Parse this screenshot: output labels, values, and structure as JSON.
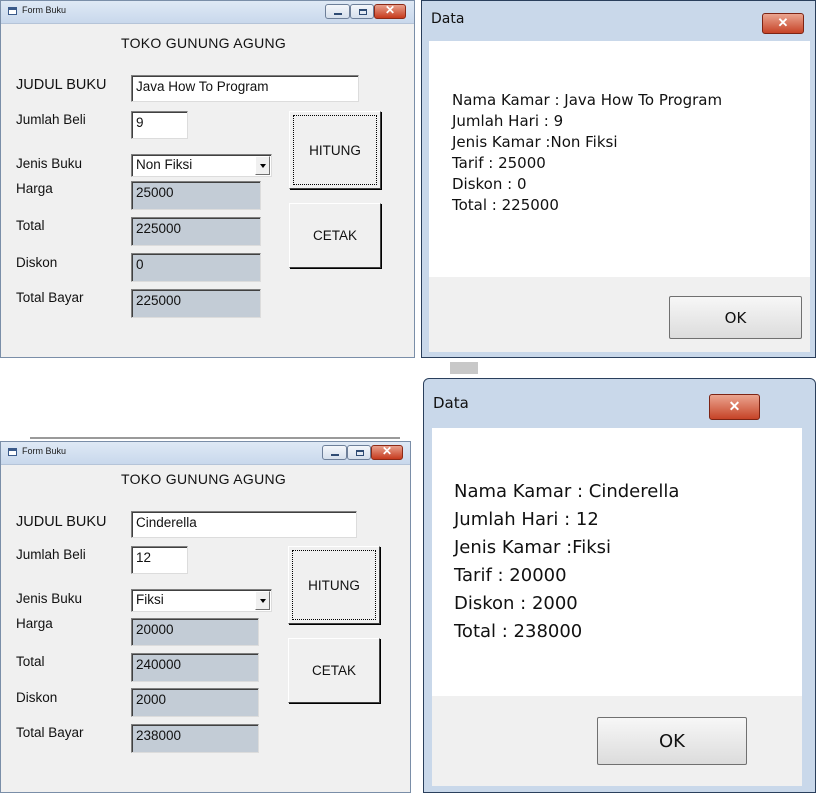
{
  "forms": [
    {
      "window_title": "Form Buku",
      "store_name": "TOKO GUNUNG AGUNG",
      "labels": {
        "judul": "JUDUL BUKU",
        "jumlah": "Jumlah Beli",
        "jenis": "Jenis Buku",
        "harga": "Harga",
        "total": "Total",
        "diskon": "Diskon",
        "total_bayar": "Total Bayar"
      },
      "values": {
        "judul": "Java How To Program",
        "jumlah": "9",
        "jenis": "Non Fiksi",
        "harga": "25000",
        "total": "225000",
        "diskon": "0",
        "total_bayar": "225000"
      },
      "buttons": {
        "hitung": "HITUNG",
        "cetak": "CETAK"
      },
      "close_glyph": "✕"
    },
    {
      "window_title": "Form Buku",
      "store_name": "TOKO GUNUNG AGUNG",
      "labels": {
        "judul": "JUDUL BUKU",
        "jumlah": "Jumlah Beli",
        "jenis": "Jenis Buku",
        "harga": "Harga",
        "total": "Total",
        "diskon": "Diskon",
        "total_bayar": "Total Bayar"
      },
      "values": {
        "judul": "Cinderella",
        "jumlah": "12",
        "jenis": "Fiksi",
        "harga": "20000",
        "total": "240000",
        "diskon": "2000",
        "total_bayar": "238000"
      },
      "buttons": {
        "hitung": "HITUNG",
        "cetak": "CETAK"
      },
      "close_glyph": "✕"
    }
  ],
  "dialogs": [
    {
      "title": "Data",
      "close_glyph": "✕",
      "lines": [
        "Nama Kamar : Java How To Program",
        "Jumlah Hari : 9",
        "Jenis Kamar :Non Fiksi",
        "Tarif : 25000",
        "Diskon : 0",
        "Total : 225000"
      ],
      "ok_label": "OK"
    },
    {
      "title": "Data",
      "close_glyph": "✕",
      "lines": [
        "Nama Kamar : Cinderella",
        "Jumlah Hari : 12",
        "Jenis Kamar :Fiksi",
        "Tarif : 20000",
        "Diskon : 2000",
        "Total : 238000"
      ],
      "ok_label": "OK"
    }
  ],
  "colors": {
    "form_bg": "#f0f0f0",
    "readonly_field": "#c3ccd6",
    "dialog_frame": "#c9d8ea",
    "close_red": "#c63a1e"
  }
}
